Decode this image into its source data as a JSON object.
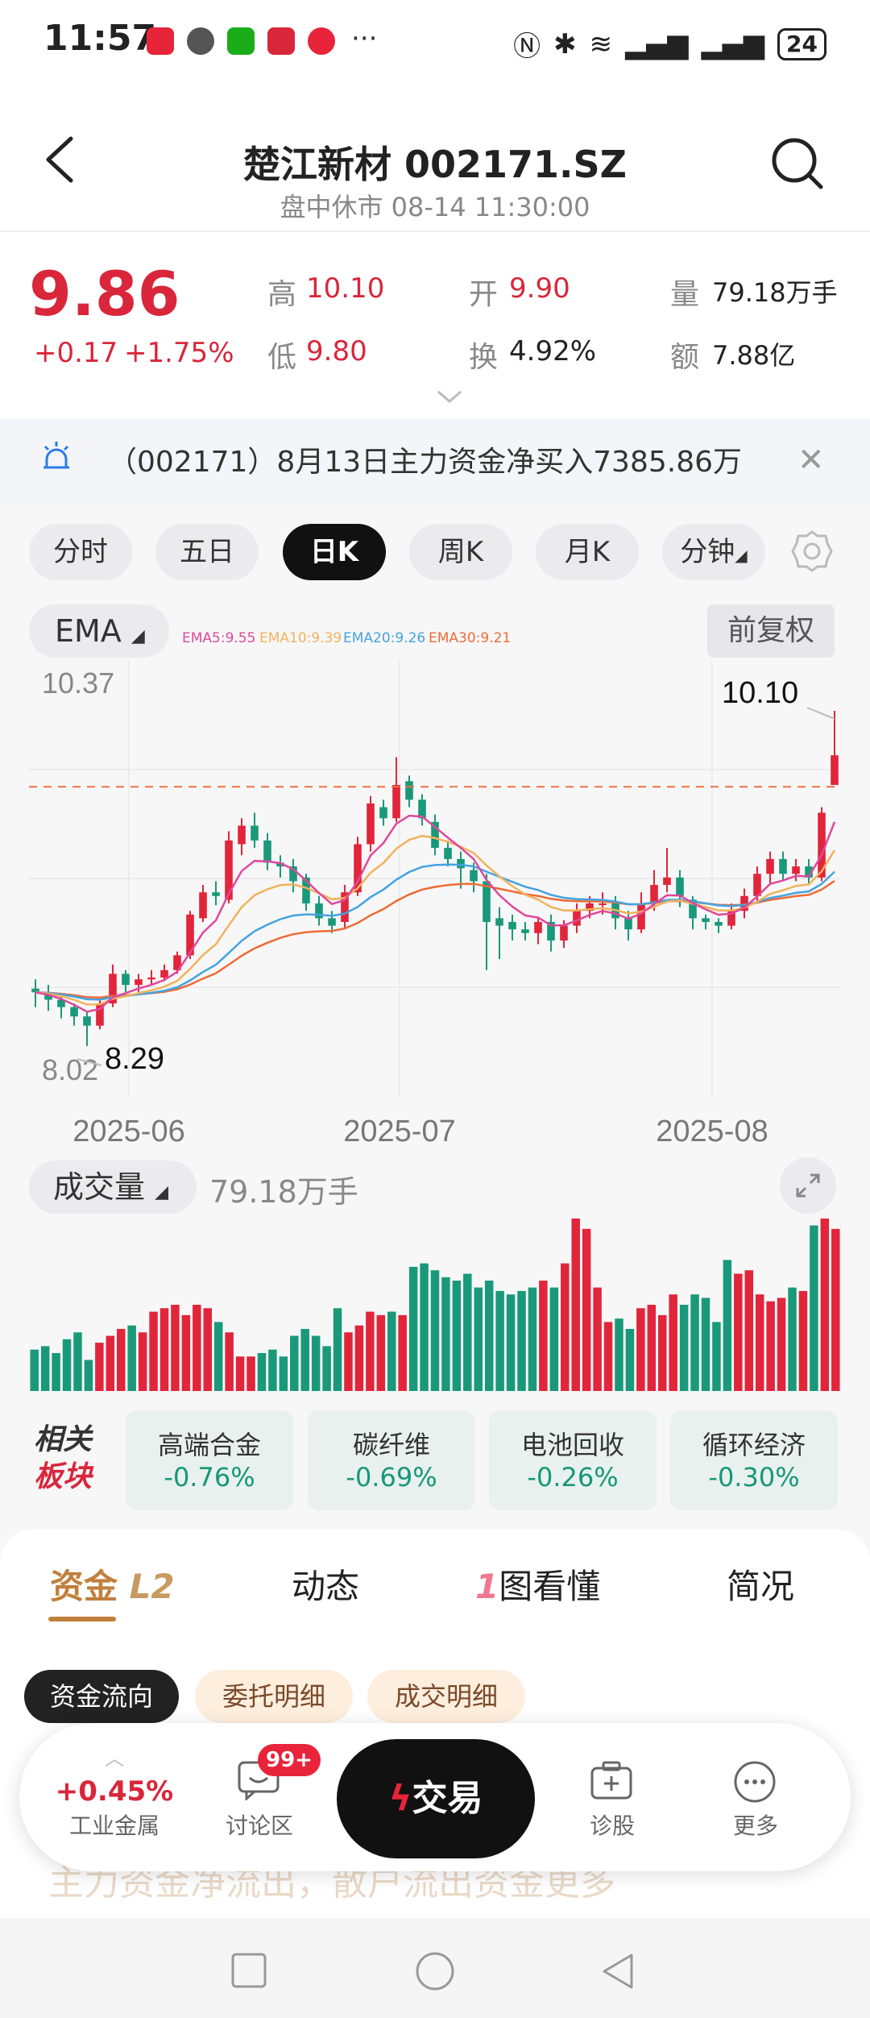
{
  "status_bar": {
    "time": "11:57",
    "battery": "24"
  },
  "header": {
    "title": "楚江新材 002171.SZ",
    "subtitle": "盘中休市 08-14 11:30:00"
  },
  "quote": {
    "price": "9.86",
    "change": "+0.17",
    "change_pct": "+1.75%",
    "high_label": "高",
    "high": "10.10",
    "low_label": "低",
    "low": "9.80",
    "open_label": "开",
    "open": "9.90",
    "turnover_label": "换",
    "turnover": "4.92%",
    "volume_label": "量",
    "volume": "79.18万手",
    "amount_label": "额",
    "amount": "7.88亿"
  },
  "news": {
    "text": "（002171）8月13日主力资金净买入7385.86万"
  },
  "period_tabs": [
    {
      "label": "分时",
      "active": false
    },
    {
      "label": "五日",
      "active": false
    },
    {
      "label": "日K",
      "active": true
    },
    {
      "label": "周K",
      "active": false
    },
    {
      "label": "月K",
      "active": false
    },
    {
      "label": "分钟",
      "active": false
    }
  ],
  "indicator": {
    "button": "EMA",
    "ema5": "EMA5:9.55",
    "ema10": "EMA10:9.39",
    "ema20": "EMA20:9.26",
    "ema30": "EMA30:9.21",
    "adjust": "前复权"
  },
  "chart_data": {
    "type": "candlestick",
    "y_top_label": "10.37",
    "y_bottom_label": "8.02",
    "ylim": [
      8.02,
      10.37
    ],
    "x_labels": [
      "2025-06",
      "2025-07",
      "2025-08"
    ],
    "max_annotation": "10.10",
    "min_annotation": "8.29",
    "reference_price": 9.69,
    "colors": {
      "up": "#e1253a",
      "down": "#19997a",
      "ema5": "#e0489b",
      "ema10": "#f1b25a",
      "ema20": "#44a3e0",
      "ema30": "#ee6b34"
    },
    "candles": [
      [
        8.6,
        8.58,
        8.65,
        8.5
      ],
      [
        8.58,
        8.54,
        8.62,
        8.48
      ],
      [
        8.54,
        8.5,
        8.57,
        8.44
      ],
      [
        8.5,
        8.45,
        8.52,
        8.4
      ],
      [
        8.45,
        8.4,
        8.48,
        8.29
      ],
      [
        8.4,
        8.52,
        8.55,
        8.38
      ],
      [
        8.52,
        8.68,
        8.73,
        8.5
      ],
      [
        8.68,
        8.62,
        8.7,
        8.58
      ],
      [
        8.62,
        8.65,
        8.68,
        8.58
      ],
      [
        8.65,
        8.66,
        8.7,
        8.62
      ],
      [
        8.66,
        8.7,
        8.73,
        8.64
      ],
      [
        8.7,
        8.78,
        8.8,
        8.68
      ],
      [
        8.78,
        9.0,
        9.02,
        8.76
      ],
      [
        8.98,
        9.12,
        9.16,
        8.96
      ],
      [
        9.12,
        9.1,
        9.18,
        9.05
      ],
      [
        9.08,
        9.4,
        9.45,
        9.06
      ],
      [
        9.38,
        9.48,
        9.52,
        9.32
      ],
      [
        9.48,
        9.4,
        9.55,
        9.36
      ],
      [
        9.4,
        9.28,
        9.44,
        9.24
      ],
      [
        9.28,
        9.26,
        9.32,
        9.2
      ],
      [
        9.26,
        9.18,
        9.3,
        9.12
      ],
      [
        9.2,
        9.06,
        9.22,
        9.02
      ],
      [
        9.06,
        8.98,
        9.1,
        8.94
      ],
      [
        8.98,
        8.94,
        9.02,
        8.9
      ],
      [
        8.96,
        9.12,
        9.16,
        8.92
      ],
      [
        9.12,
        9.38,
        9.42,
        9.1
      ],
      [
        9.38,
        9.6,
        9.64,
        9.34
      ],
      [
        9.58,
        9.52,
        9.62,
        9.48
      ],
      [
        9.52,
        9.7,
        9.85,
        9.5
      ],
      [
        9.72,
        9.62,
        9.75,
        9.58
      ],
      [
        9.62,
        9.52,
        9.65,
        9.48
      ],
      [
        9.5,
        9.36,
        9.54,
        9.32
      ],
      [
        9.36,
        9.3,
        9.4,
        9.26
      ],
      [
        9.3,
        9.25,
        9.34,
        9.14
      ],
      [
        9.24,
        9.18,
        9.28,
        9.12
      ],
      [
        9.18,
        8.96,
        9.22,
        8.7
      ],
      [
        8.98,
        8.94,
        9.04,
        8.76
      ],
      [
        8.96,
        8.92,
        9.0,
        8.86
      ],
      [
        8.92,
        8.9,
        8.96,
        8.86
      ],
      [
        8.9,
        8.96,
        8.98,
        8.84
      ],
      [
        8.96,
        8.86,
        9.0,
        8.8
      ],
      [
        8.86,
        8.94,
        8.97,
        8.82
      ],
      [
        8.94,
        9.02,
        9.06,
        8.9
      ],
      [
        9.02,
        9.06,
        9.1,
        8.98
      ],
      [
        9.06,
        9.06,
        9.12,
        9.0
      ],
      [
        9.06,
        8.98,
        9.1,
        8.92
      ],
      [
        8.98,
        8.92,
        9.02,
        8.86
      ],
      [
        8.92,
        9.06,
        9.12,
        8.9
      ],
      [
        9.06,
        9.16,
        9.24,
        9.02
      ],
      [
        9.16,
        9.2,
        9.36,
        9.12
      ],
      [
        9.2,
        9.1,
        9.24,
        9.04
      ],
      [
        9.08,
        8.98,
        9.1,
        8.92
      ],
      [
        8.98,
        8.96,
        9.0,
        8.92
      ],
      [
        8.96,
        8.94,
        8.98,
        8.9
      ],
      [
        8.94,
        9.02,
        9.06,
        8.92
      ],
      [
        9.02,
        9.1,
        9.14,
        8.98
      ],
      [
        9.1,
        9.22,
        9.26,
        9.06
      ],
      [
        9.22,
        9.3,
        9.34,
        9.16
      ],
      [
        9.3,
        9.22,
        9.34,
        9.18
      ],
      [
        9.22,
        9.26,
        9.3,
        9.18
      ],
      [
        9.26,
        9.2,
        9.3,
        9.16
      ],
      [
        9.2,
        9.55,
        9.58,
        9.18
      ],
      [
        9.7,
        9.86,
        10.1,
        9.8
      ]
    ],
    "volume_label": "成交量",
    "volume_value": "79.18万手",
    "volumes": [
      24,
      26,
      22,
      30,
      34,
      18,
      28,
      32,
      36,
      38,
      34,
      46,
      48,
      50,
      44,
      50,
      48,
      40,
      34,
      20,
      20,
      22,
      24,
      20,
      32,
      36,
      32,
      26,
      48,
      34,
      38,
      46,
      44,
      46,
      44,
      72,
      74,
      70,
      66,
      64,
      68,
      60,
      64,
      58,
      56,
      58,
      60,
      64,
      60,
      74,
      100,
      94,
      60,
      40,
      42,
      36,
      48,
      50,
      44,
      56,
      50,
      56,
      54,
      40,
      76,
      68,
      70,
      56,
      52,
      54,
      60,
      58,
      96,
      100,
      94
    ],
    "volume_max": 100
  },
  "sectors": {
    "title": "相关板块",
    "items": [
      {
        "name": "高端合金",
        "value": "-0.76%"
      },
      {
        "name": "碳纤维",
        "value": "-0.69%"
      },
      {
        "name": "电池回收",
        "value": "-0.26%"
      },
      {
        "name": "循环经济",
        "value": "-0.30%"
      }
    ]
  },
  "main_tabs": [
    {
      "label": "资金",
      "badge": "L2",
      "active": true
    },
    {
      "label": "动态",
      "active": false
    },
    {
      "label": "图看懂",
      "prefix": "1",
      "active": false
    },
    {
      "label": "简况",
      "active": false
    }
  ],
  "sub_tabs": [
    {
      "label": "资金流向",
      "active": true
    },
    {
      "label": "委托明细",
      "active": false
    },
    {
      "label": "成交明细",
      "active": false
    }
  ],
  "float_bar": {
    "industry_pct": "+0.45%",
    "industry_label": "工业金属",
    "discuss_label": "讨论区",
    "discuss_badge": "99+",
    "trade_label": "交易",
    "diagnose_label": "诊股",
    "more_label": "更多"
  },
  "background_text": "主力资金净流出，散户流出资金更多"
}
